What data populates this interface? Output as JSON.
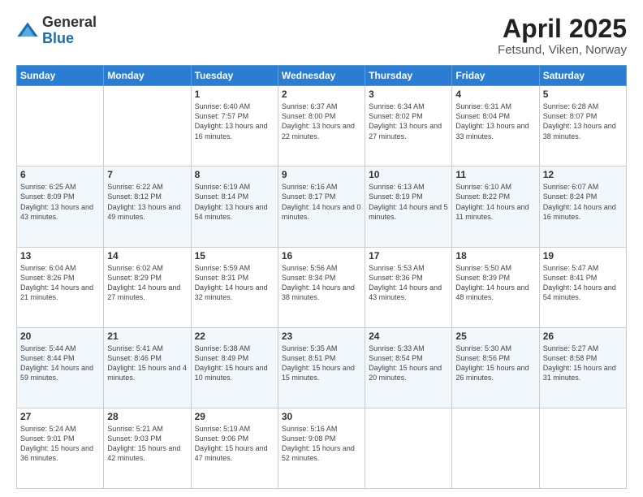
{
  "header": {
    "logo_general": "General",
    "logo_blue": "Blue",
    "title": "April 2025",
    "location": "Fetsund, Viken, Norway"
  },
  "days_of_week": [
    "Sunday",
    "Monday",
    "Tuesday",
    "Wednesday",
    "Thursday",
    "Friday",
    "Saturday"
  ],
  "weeks": [
    [
      {
        "day": "",
        "info": ""
      },
      {
        "day": "",
        "info": ""
      },
      {
        "day": "1",
        "info": "Sunrise: 6:40 AM\nSunset: 7:57 PM\nDaylight: 13 hours and 16 minutes."
      },
      {
        "day": "2",
        "info": "Sunrise: 6:37 AM\nSunset: 8:00 PM\nDaylight: 13 hours and 22 minutes."
      },
      {
        "day": "3",
        "info": "Sunrise: 6:34 AM\nSunset: 8:02 PM\nDaylight: 13 hours and 27 minutes."
      },
      {
        "day": "4",
        "info": "Sunrise: 6:31 AM\nSunset: 8:04 PM\nDaylight: 13 hours and 33 minutes."
      },
      {
        "day": "5",
        "info": "Sunrise: 6:28 AM\nSunset: 8:07 PM\nDaylight: 13 hours and 38 minutes."
      }
    ],
    [
      {
        "day": "6",
        "info": "Sunrise: 6:25 AM\nSunset: 8:09 PM\nDaylight: 13 hours and 43 minutes."
      },
      {
        "day": "7",
        "info": "Sunrise: 6:22 AM\nSunset: 8:12 PM\nDaylight: 13 hours and 49 minutes."
      },
      {
        "day": "8",
        "info": "Sunrise: 6:19 AM\nSunset: 8:14 PM\nDaylight: 13 hours and 54 minutes."
      },
      {
        "day": "9",
        "info": "Sunrise: 6:16 AM\nSunset: 8:17 PM\nDaylight: 14 hours and 0 minutes."
      },
      {
        "day": "10",
        "info": "Sunrise: 6:13 AM\nSunset: 8:19 PM\nDaylight: 14 hours and 5 minutes."
      },
      {
        "day": "11",
        "info": "Sunrise: 6:10 AM\nSunset: 8:22 PM\nDaylight: 14 hours and 11 minutes."
      },
      {
        "day": "12",
        "info": "Sunrise: 6:07 AM\nSunset: 8:24 PM\nDaylight: 14 hours and 16 minutes."
      }
    ],
    [
      {
        "day": "13",
        "info": "Sunrise: 6:04 AM\nSunset: 8:26 PM\nDaylight: 14 hours and 21 minutes."
      },
      {
        "day": "14",
        "info": "Sunrise: 6:02 AM\nSunset: 8:29 PM\nDaylight: 14 hours and 27 minutes."
      },
      {
        "day": "15",
        "info": "Sunrise: 5:59 AM\nSunset: 8:31 PM\nDaylight: 14 hours and 32 minutes."
      },
      {
        "day": "16",
        "info": "Sunrise: 5:56 AM\nSunset: 8:34 PM\nDaylight: 14 hours and 38 minutes."
      },
      {
        "day": "17",
        "info": "Sunrise: 5:53 AM\nSunset: 8:36 PM\nDaylight: 14 hours and 43 minutes."
      },
      {
        "day": "18",
        "info": "Sunrise: 5:50 AM\nSunset: 8:39 PM\nDaylight: 14 hours and 48 minutes."
      },
      {
        "day": "19",
        "info": "Sunrise: 5:47 AM\nSunset: 8:41 PM\nDaylight: 14 hours and 54 minutes."
      }
    ],
    [
      {
        "day": "20",
        "info": "Sunrise: 5:44 AM\nSunset: 8:44 PM\nDaylight: 14 hours and 59 minutes."
      },
      {
        "day": "21",
        "info": "Sunrise: 5:41 AM\nSunset: 8:46 PM\nDaylight: 15 hours and 4 minutes."
      },
      {
        "day": "22",
        "info": "Sunrise: 5:38 AM\nSunset: 8:49 PM\nDaylight: 15 hours and 10 minutes."
      },
      {
        "day": "23",
        "info": "Sunrise: 5:35 AM\nSunset: 8:51 PM\nDaylight: 15 hours and 15 minutes."
      },
      {
        "day": "24",
        "info": "Sunrise: 5:33 AM\nSunset: 8:54 PM\nDaylight: 15 hours and 20 minutes."
      },
      {
        "day": "25",
        "info": "Sunrise: 5:30 AM\nSunset: 8:56 PM\nDaylight: 15 hours and 26 minutes."
      },
      {
        "day": "26",
        "info": "Sunrise: 5:27 AM\nSunset: 8:58 PM\nDaylight: 15 hours and 31 minutes."
      }
    ],
    [
      {
        "day": "27",
        "info": "Sunrise: 5:24 AM\nSunset: 9:01 PM\nDaylight: 15 hours and 36 minutes."
      },
      {
        "day": "28",
        "info": "Sunrise: 5:21 AM\nSunset: 9:03 PM\nDaylight: 15 hours and 42 minutes."
      },
      {
        "day": "29",
        "info": "Sunrise: 5:19 AM\nSunset: 9:06 PM\nDaylight: 15 hours and 47 minutes."
      },
      {
        "day": "30",
        "info": "Sunrise: 5:16 AM\nSunset: 9:08 PM\nDaylight: 15 hours and 52 minutes."
      },
      {
        "day": "",
        "info": ""
      },
      {
        "day": "",
        "info": ""
      },
      {
        "day": "",
        "info": ""
      }
    ]
  ]
}
